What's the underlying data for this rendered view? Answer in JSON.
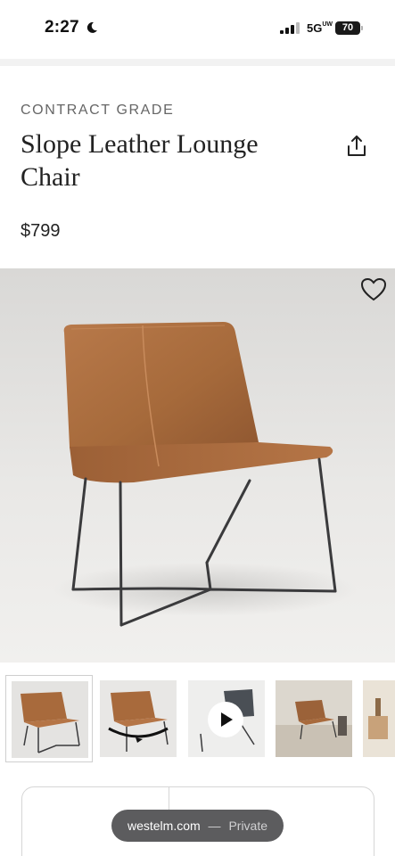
{
  "status_bar": {
    "time": "2:27",
    "network": "5G",
    "network_suffix": "UW",
    "battery": "70"
  },
  "product": {
    "eyebrow": "CONTRACT GRADE",
    "title": "Slope Leather Lounge Chair",
    "price": "$799"
  },
  "gallery": {
    "thumbnails": [
      {
        "label": "main view",
        "selected": true
      },
      {
        "label": "360°"
      },
      {
        "label": "video"
      },
      {
        "label": "room view"
      },
      {
        "label": "room view 2"
      }
    ],
    "badge_360": "360°"
  },
  "browser": {
    "domain": "westelm.com",
    "separator": "—",
    "mode": "Private"
  },
  "colors": {
    "leather": "#a86a3c",
    "frame": "#3a3a3c",
    "pill": "#5c5c5e"
  }
}
